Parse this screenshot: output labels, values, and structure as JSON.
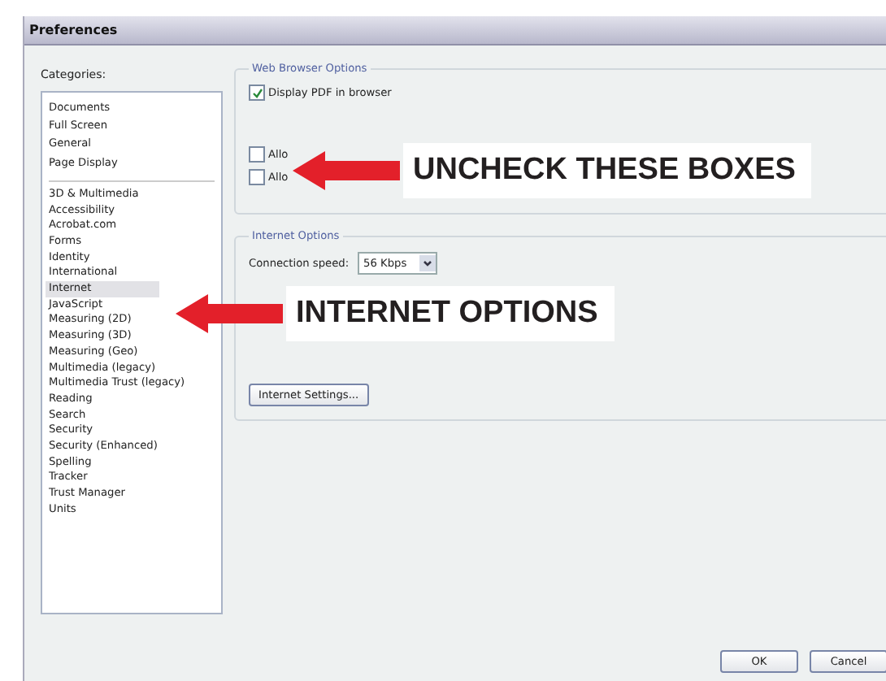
{
  "window": {
    "title": "Preferences"
  },
  "categories": {
    "label": "Categories:",
    "groups": [
      [
        {
          "label": "Documents",
          "selected": false
        },
        {
          "label": "Full Screen",
          "selected": false
        },
        {
          "label": "General",
          "selected": false
        },
        {
          "label": "Page Display",
          "selected": false
        }
      ],
      [
        {
          "label": "3D & Multimedia",
          "selected": false
        },
        {
          "label": "Accessibility",
          "selected": false
        },
        {
          "label": "Acrobat.com",
          "selected": false
        },
        {
          "label": "Forms",
          "selected": false
        },
        {
          "label": "Identity",
          "selected": false
        },
        {
          "label": "International",
          "selected": false
        },
        {
          "label": "Internet",
          "selected": true
        },
        {
          "label": "JavaScript",
          "selected": false
        },
        {
          "label": "Measuring (2D)",
          "selected": false
        },
        {
          "label": "Measuring (3D)",
          "selected": false
        },
        {
          "label": "Measuring (Geo)",
          "selected": false
        },
        {
          "label": "Multimedia (legacy)",
          "selected": false
        },
        {
          "label": "Multimedia Trust (legacy)",
          "selected": false
        },
        {
          "label": "Reading",
          "selected": false
        },
        {
          "label": "Search",
          "selected": false
        },
        {
          "label": "Security",
          "selected": false
        },
        {
          "label": "Security (Enhanced)",
          "selected": false
        },
        {
          "label": "Spelling",
          "selected": false
        },
        {
          "label": "Tracker",
          "selected": false
        },
        {
          "label": "Trust Manager",
          "selected": false
        },
        {
          "label": "Units",
          "selected": false
        }
      ]
    ]
  },
  "web_browser_options": {
    "title": "Web Browser Options",
    "checkboxes": [
      {
        "label": "Display PDF in browser",
        "checked": true
      },
      {
        "label": "Allo",
        "checked": false
      },
      {
        "label": "Allo",
        "checked": false
      }
    ]
  },
  "internet_options": {
    "title": "Internet Options",
    "connection_speed_label": "Connection speed:",
    "connection_speed_value": "56 Kbps",
    "settings_button": "Internet Settings..."
  },
  "buttons": [
    "OK",
    "Cancel"
  ],
  "callouts": [
    {
      "text": "UNCHECK THESE BOXES"
    },
    {
      "text": "INTERNET OPTIONS"
    }
  ]
}
